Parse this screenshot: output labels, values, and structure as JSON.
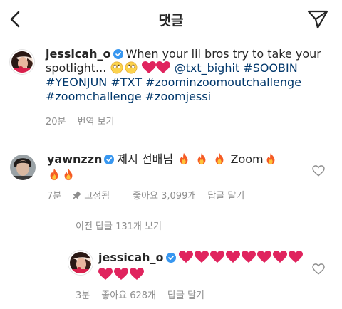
{
  "header": {
    "title": "댓글",
    "back_icon": "chevron-left-icon",
    "send_icon": "paper-plane-icon"
  },
  "caption": {
    "username": "jessicah_o",
    "text": "When your lil bros try to take your spotlight...",
    "mention": "@txt_bighit",
    "hashtags_line1": "#SOOBIN",
    "hashtags_line2": "#YEONJUN #TXT #zoominzoomoutchallenge",
    "hashtags_line3": "#zoomchallenge #zoomjessi",
    "time": "20분",
    "see_translation": "번역 보기"
  },
  "comment": {
    "username": "yawnzzn",
    "text_before": "제시 선배님",
    "text_zoom": "Zoom",
    "time": "7분",
    "pinned": "고정됨",
    "likes": "좋아요 3,099개",
    "reply": "답글 달기"
  },
  "view_replies": "이전 답글 131개 보기",
  "reply": {
    "username": "jessicah_o",
    "time": "3분",
    "likes": "좋아요 628개",
    "reply": "답글 달기"
  },
  "colors": {
    "text": "#262626",
    "meta": "#8e8e8e",
    "link": "#00376b",
    "verified": "#3897f0",
    "heart": "#e0245e"
  }
}
